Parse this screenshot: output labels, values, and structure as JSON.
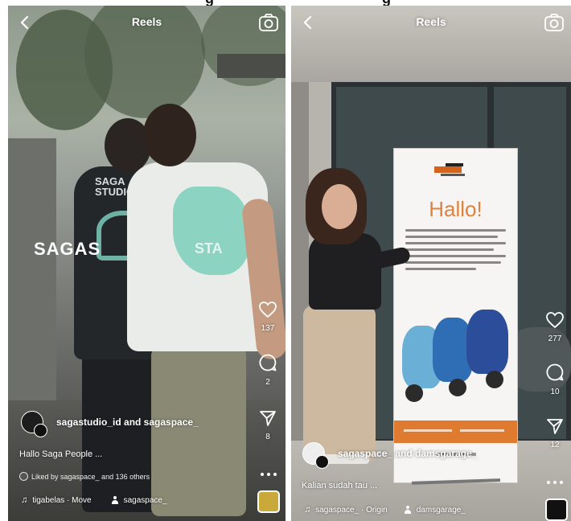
{
  "left_reel": {
    "header": {
      "title": "Reels",
      "back_icon": "chevron-left-icon",
      "camera_icon": "camera-icon"
    },
    "video_watermark": {
      "primary": "SAGAS",
      "secondary": "STA"
    },
    "shirt_text": "SAGA STUDIO",
    "actions": {
      "like_count": "137",
      "comment_count": "2",
      "share_count": "8"
    },
    "authors": "sagastudio_id and sagaspace_",
    "caption": "Hallo Saga People ...",
    "liked_by": "Liked by sagaspace_ and 136 others",
    "audio": {
      "track": "tigabelas · Move",
      "tagged": "sagaspace_"
    }
  },
  "right_reel": {
    "header": {
      "title": "Reels",
      "back_icon": "chevron-left-icon",
      "camera_icon": "camera-icon"
    },
    "banner": {
      "headline": "Hallo!"
    },
    "actions": {
      "like_count": "277",
      "comment_count": "10",
      "share_count": "12"
    },
    "authors": "sagaspace_ and damsgarage_",
    "caption": "Kalian sudah tau ...",
    "audio": {
      "track": "sagaspace_ · Origin",
      "tagged": "damsgarage_"
    }
  },
  "colors": {
    "banner_accent": "#e0823d",
    "shirt_print": "#7ccfbb",
    "ui_text": "#ffffff"
  }
}
